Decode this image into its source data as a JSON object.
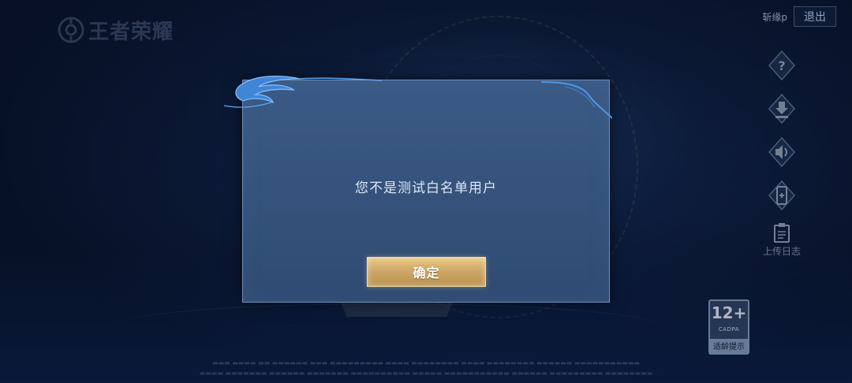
{
  "logo": {
    "text": "王者荣耀",
    "icon": "game-logo-icon"
  },
  "header": {
    "account_name": "斩缘p",
    "logout_label": "退出"
  },
  "side_menu": {
    "items": [
      {
        "icon": "help-icon"
      },
      {
        "icon": "download-icon"
      },
      {
        "icon": "sound-icon"
      },
      {
        "icon": "phone-icon"
      },
      {
        "icon": "clipboard-icon",
        "label": "上传日志"
      }
    ]
  },
  "dialog": {
    "message": "您不是测试白名单用户",
    "confirm_label": "确定"
  },
  "age_rating": {
    "number": "12+",
    "org": "CADPA",
    "tip": "适龄提示"
  },
  "colors": {
    "dialog_bg": "#34527b",
    "dialog_border": "#6f8fb8",
    "button_gold": "#cfa868",
    "background": "#0b1730"
  }
}
